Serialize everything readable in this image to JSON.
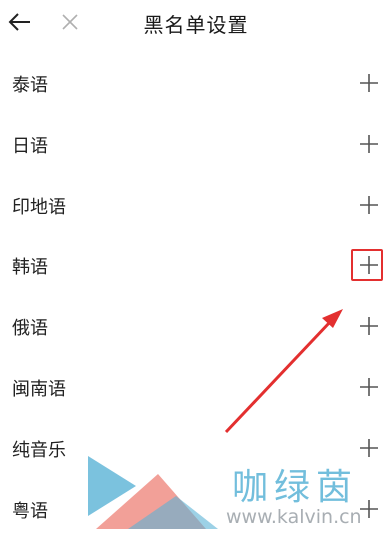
{
  "header": {
    "title": "黑名单设置",
    "back_icon": "back-arrow-icon",
    "close_icon": "close-icon"
  },
  "languages": [
    {
      "label": "泰语"
    },
    {
      "label": "日语"
    },
    {
      "label": "印地语"
    },
    {
      "label": "韩语"
    },
    {
      "label": "俄语"
    },
    {
      "label": "闽南语"
    },
    {
      "label": "纯音乐"
    },
    {
      "label": "粤语"
    }
  ],
  "add_icon": "plus-icon",
  "annotation": {
    "highlight_color": "#e32f2f",
    "highlighted_row": "韩语"
  },
  "watermark": {
    "text": "咖绿茵",
    "url": "www.kalvin.cn",
    "colors": [
      "#5ab3d6",
      "#f08f86"
    ]
  }
}
